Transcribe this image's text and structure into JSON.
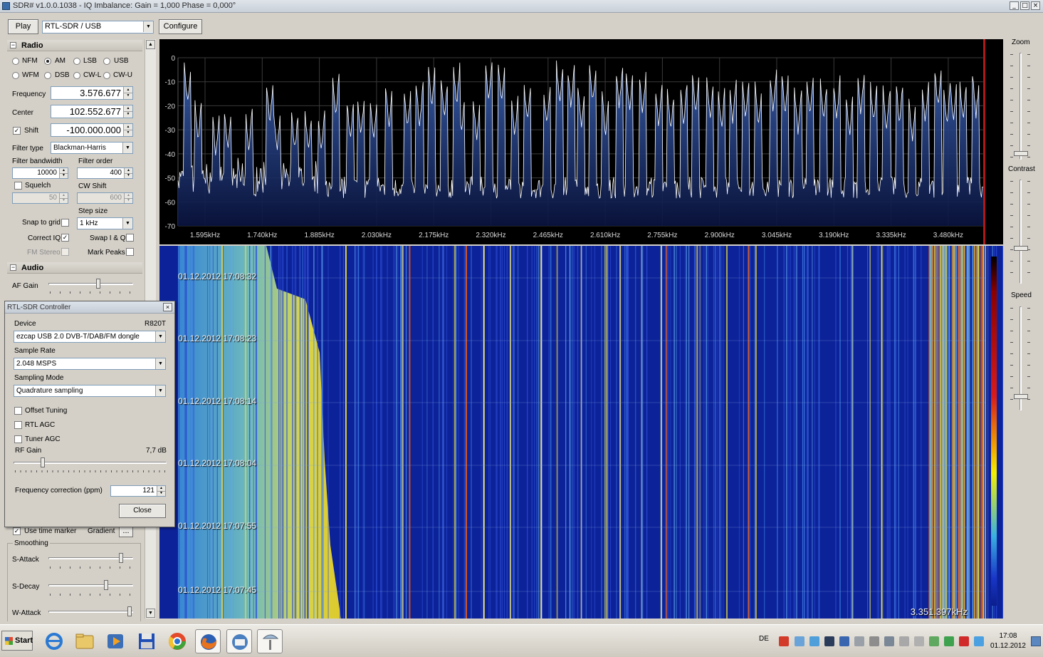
{
  "window": {
    "title": "SDR# v1.0.0.1038 - IQ Imbalance: Gain = 1,000 Phase = 0,000°"
  },
  "toolbar": {
    "play_label": "Play",
    "source_value": "RTL-SDR / USB",
    "configure_label": "Configure"
  },
  "radio": {
    "section_title": "Radio",
    "modes": [
      {
        "label": "NFM",
        "checked": false
      },
      {
        "label": "AM",
        "checked": true
      },
      {
        "label": "LSB",
        "checked": false
      },
      {
        "label": "USB",
        "checked": false
      },
      {
        "label": "WFM",
        "checked": false
      },
      {
        "label": "DSB",
        "checked": false
      },
      {
        "label": "CW-L",
        "checked": false
      },
      {
        "label": "CW-U",
        "checked": false
      }
    ],
    "frequency_label": "Frequency",
    "frequency_value": "3.576.677",
    "center_label": "Center",
    "center_value": "102.552.677",
    "shift_label": "Shift",
    "shift_value": "-100.000.000",
    "filter_type_label": "Filter type",
    "filter_type_value": "Blackman-Harris",
    "filter_bandwidth_label": "Filter bandwidth",
    "filter_bandwidth_value": "10000",
    "filter_order_label": "Filter order",
    "filter_order_value": "400",
    "squelch_label": "Squelch",
    "squelch_value": "50",
    "cw_shift_label": "CW Shift",
    "cw_shift_value": "600",
    "step_size_label": "Step size",
    "step_size_value": "1 kHz",
    "snap_label": "Snap to grid",
    "correct_iq_label": "Correct IQ",
    "swap_iq_label": "Swap I & Q",
    "fm_stereo_label": "FM Stereo",
    "mark_peaks_label": "Mark Peaks"
  },
  "audio": {
    "section_title": "Audio",
    "af_gain_label": "AF Gain"
  },
  "display": {
    "use_time_marker_label": "Use time marker",
    "gradient_label": "Gradient",
    "gradient_button": "...",
    "smoothing_label": "Smoothing",
    "s_attack_label": "S-Attack",
    "s_decay_label": "S-Decay",
    "w_attack_label": "W-Attack"
  },
  "right_panel": {
    "zoom_label": "Zoom",
    "contrast_label": "Contrast",
    "speed_label": "Speed"
  },
  "rtl_dialog": {
    "title": "RTL-SDR Controller",
    "device_label": "Device",
    "tuner": "R820T",
    "device_value": "ezcap USB 2.0 DVB-T/DAB/FM dongle",
    "sample_rate_label": "Sample Rate",
    "sample_rate_value": "2.048 MSPS",
    "sampling_mode_label": "Sampling Mode",
    "sampling_mode_value": "Quadrature sampling",
    "offset_tuning_label": "Offset Tuning",
    "rtl_agc_label": "RTL AGC",
    "tuner_agc_label": "Tuner AGC",
    "rf_gain_label": "RF Gain",
    "rf_gain_value": "7,7 dB",
    "freq_corr_label": "Frequency correction (ppm)",
    "freq_corr_value": "121",
    "close_label": "Close"
  },
  "spectrum": {
    "y_ticks": [
      "0",
      "-10",
      "-20",
      "-30",
      "-40",
      "-50",
      "-60",
      "-70"
    ],
    "x_ticks": [
      "1.595kHz",
      "1.740kHz",
      "1.885kHz",
      "2.030kHz",
      "2.175kHz",
      "2.320kHz",
      "2.465kHz",
      "2.610kHz",
      "2.755kHz",
      "2.900kHz",
      "3.045kHz",
      "3.190kHz",
      "3.335kHz",
      "3.480kHz"
    ],
    "ylim": [
      -70,
      0
    ],
    "peaks": [
      {
        "f": 0.012,
        "db": -21
      },
      {
        "f": 0.025,
        "db": -36
      },
      {
        "f": 0.047,
        "db": -42
      },
      {
        "f": 0.062,
        "db": -41
      },
      {
        "f": 0.088,
        "db": -40
      },
      {
        "f": 0.114,
        "db": -29
      },
      {
        "f": 0.123,
        "db": -41
      },
      {
        "f": 0.145,
        "db": -41
      },
      {
        "f": 0.162,
        "db": -41
      },
      {
        "f": 0.178,
        "db": -41
      },
      {
        "f": 0.196,
        "db": -25
      },
      {
        "f": 0.214,
        "db": -36
      },
      {
        "f": 0.227,
        "db": -35
      },
      {
        "f": 0.243,
        "db": -36
      },
      {
        "f": 0.262,
        "db": -30
      },
      {
        "f": 0.285,
        "db": -32
      },
      {
        "f": 0.3,
        "db": -30
      },
      {
        "f": 0.315,
        "db": -22
      },
      {
        "f": 0.331,
        "db": -27
      },
      {
        "f": 0.346,
        "db": -21
      },
      {
        "f": 0.352,
        "db": -33
      },
      {
        "f": 0.371,
        "db": -36
      },
      {
        "f": 0.386,
        "db": -20
      },
      {
        "f": 0.402,
        "db": -20
      },
      {
        "f": 0.418,
        "db": -35
      },
      {
        "f": 0.434,
        "db": -29
      },
      {
        "f": 0.458,
        "db": -30
      },
      {
        "f": 0.474,
        "db": -20
      },
      {
        "f": 0.488,
        "db": -22
      },
      {
        "f": 0.501,
        "db": -31
      },
      {
        "f": 0.515,
        "db": -21
      },
      {
        "f": 0.531,
        "db": -34
      },
      {
        "f": 0.548,
        "db": -22
      },
      {
        "f": 0.561,
        "db": -24
      },
      {
        "f": 0.577,
        "db": -25
      },
      {
        "f": 0.597,
        "db": -30
      },
      {
        "f": 0.612,
        "db": -32
      },
      {
        "f": 0.628,
        "db": -29
      },
      {
        "f": 0.643,
        "db": -25
      },
      {
        "f": 0.661,
        "db": -28
      },
      {
        "f": 0.675,
        "db": -31
      },
      {
        "f": 0.689,
        "db": -28
      },
      {
        "f": 0.705,
        "db": -27
      },
      {
        "f": 0.721,
        "db": -30
      },
      {
        "f": 0.739,
        "db": -24
      },
      {
        "f": 0.754,
        "db": -25
      },
      {
        "f": 0.77,
        "db": -32
      },
      {
        "f": 0.785,
        "db": -26
      },
      {
        "f": 0.802,
        "db": -28
      },
      {
        "f": 0.818,
        "db": -27
      },
      {
        "f": 0.834,
        "db": -34
      },
      {
        "f": 0.848,
        "db": -25
      },
      {
        "f": 0.864,
        "db": -29
      },
      {
        "f": 0.88,
        "db": -32
      },
      {
        "f": 0.896,
        "db": -29
      },
      {
        "f": 0.912,
        "db": -36
      },
      {
        "f": 0.928,
        "db": -28
      },
      {
        "f": 0.944,
        "db": -23
      },
      {
        "f": 0.955,
        "db": -30
      },
      {
        "f": 0.963,
        "db": -28
      },
      {
        "f": 0.975,
        "db": -28
      },
      {
        "f": 0.991,
        "db": -26
      }
    ]
  },
  "waterfall": {
    "timestamps": [
      "01.12.2012 17:08:32",
      "01.12.2012 17:08:23",
      "01.12.2012 17:08:14",
      "01.12.2012 17:08:04",
      "01.12.2012 17:07:55",
      "01.12.2012 17:07:45"
    ],
    "readout": "3.351.397kHz"
  },
  "taskbar": {
    "start_label": "Start",
    "lang": "DE",
    "time": "17:08",
    "date": "01.12.2012"
  },
  "colors": {
    "spectrum_bg": "#000000",
    "trace": "#ffffff",
    "waterfall_bg": "#0b1e8c",
    "hot": "#f4f000"
  }
}
